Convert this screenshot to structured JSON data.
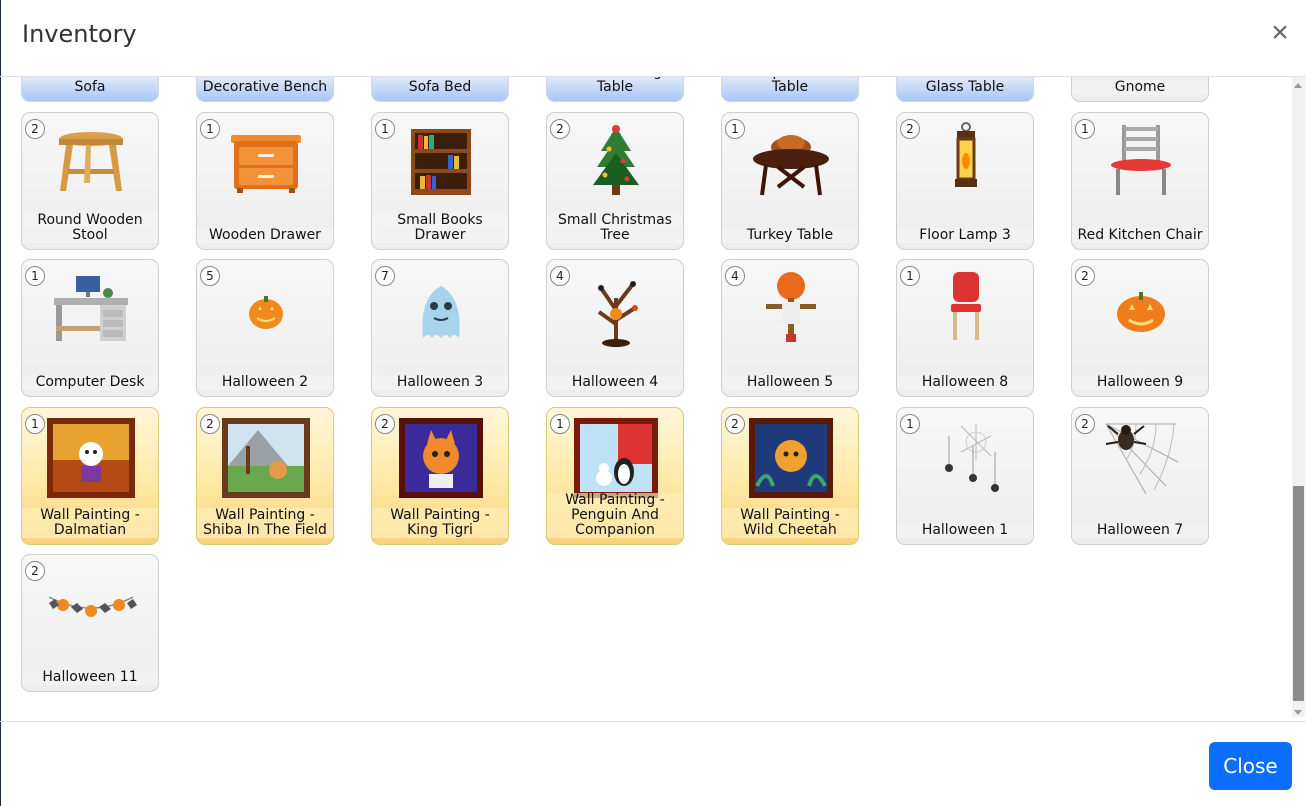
{
  "modal": {
    "title": "Inventory",
    "close_label": "Close",
    "close_x": "×"
  },
  "items": [
    {
      "label": "Sofa",
      "count": "",
      "style": "blue",
      "icon": "sofa-icon"
    },
    {
      "label": "Decorative Bench",
      "count": "",
      "style": "blue",
      "icon": "bench-icon"
    },
    {
      "label": "Sofa Bed",
      "count": "",
      "style": "blue",
      "icon": "sofa-bed-icon"
    },
    {
      "label": "Round Dining Table",
      "count": "",
      "style": "blue",
      "icon": "dining-table-icon"
    },
    {
      "label": "Simple Work Table",
      "count": "",
      "style": "blue",
      "icon": "work-table-icon"
    },
    {
      "label": "Glass Table",
      "count": "",
      "style": "blue",
      "icon": "glass-table-icon"
    },
    {
      "label": "Gnome",
      "count": "",
      "style": "plain",
      "icon": "gnome-icon"
    },
    {
      "label": "Round Wooden Stool",
      "count": "2",
      "style": "plain",
      "icon": "stool-icon"
    },
    {
      "label": "Wooden Drawer",
      "count": "1",
      "style": "plain",
      "icon": "drawer-icon"
    },
    {
      "label": "Small Books Drawer",
      "count": "1",
      "style": "plain",
      "icon": "bookshelf-icon"
    },
    {
      "label": "Small Christmas Tree",
      "count": "2",
      "style": "plain",
      "icon": "christmas-tree-icon"
    },
    {
      "label": "Turkey Table",
      "count": "1",
      "style": "plain",
      "icon": "turkey-table-icon"
    },
    {
      "label": "Floor Lamp 3",
      "count": "2",
      "style": "plain",
      "icon": "lantern-icon"
    },
    {
      "label": "Red Kitchen Chair",
      "count": "1",
      "style": "plain",
      "icon": "kitchen-chair-icon"
    },
    {
      "label": "Computer Desk",
      "count": "1",
      "style": "plain",
      "icon": "computer-desk-icon"
    },
    {
      "label": "Halloween 2",
      "count": "5",
      "style": "plain",
      "icon": "small-pumpkin-icon"
    },
    {
      "label": "Halloween 3",
      "count": "7",
      "style": "plain",
      "icon": "ghost-icon"
    },
    {
      "label": "Halloween 4",
      "count": "4",
      "style": "plain",
      "icon": "spooky-tree-icon"
    },
    {
      "label": "Halloween 5",
      "count": "4",
      "style": "plain",
      "icon": "scarecrow-icon"
    },
    {
      "label": "Halloween 8",
      "count": "1",
      "style": "plain",
      "icon": "red-chair-icon"
    },
    {
      "label": "Halloween 9",
      "count": "2",
      "style": "plain",
      "icon": "pumpkin-icon"
    },
    {
      "label": "Wall Painting - Dalmatian",
      "count": "1",
      "style": "gold",
      "icon": "painting-dalmatian-icon"
    },
    {
      "label": "Wall Painting - Shiba In The Field",
      "count": "2",
      "style": "gold",
      "icon": "painting-shiba-icon"
    },
    {
      "label": "Wall Painting - King Tigri",
      "count": "2",
      "style": "gold",
      "icon": "painting-tigri-icon"
    },
    {
      "label": "Wall Painting - Penguin And Companion",
      "count": "1",
      "style": "gold",
      "icon": "painting-penguin-icon"
    },
    {
      "label": "Wall Painting - Wild Cheetah",
      "count": "2",
      "style": "gold",
      "icon": "painting-cheetah-icon"
    },
    {
      "label": "Halloween 1",
      "count": "1",
      "style": "plain",
      "icon": "cobweb-spiders-icon"
    },
    {
      "label": "Halloween 7",
      "count": "2",
      "style": "plain",
      "icon": "spider-web-icon"
    },
    {
      "label": "Halloween 11",
      "count": "2",
      "style": "plain",
      "icon": "garland-icon"
    }
  ],
  "colors": {
    "primary_button": "#0d6efd",
    "blue_tile_bottom": "#a8c6f6",
    "gold_tile_bottom": "#f7d27a"
  }
}
